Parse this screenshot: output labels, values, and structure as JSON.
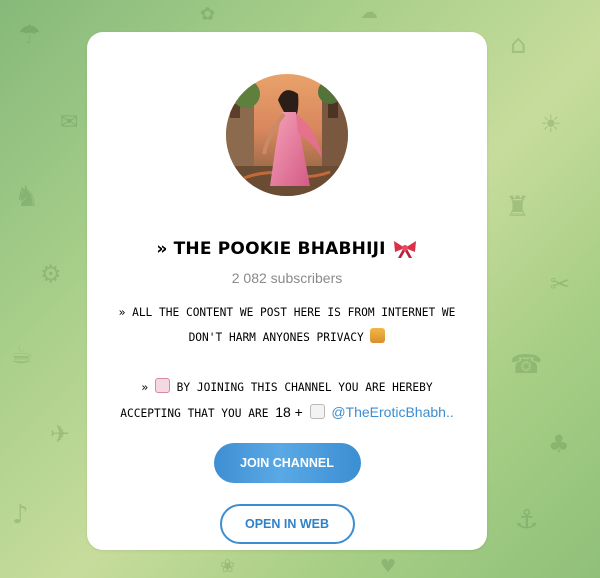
{
  "channel": {
    "title": "» THE POOKIE BHABHIJI",
    "title_icon": "ribbon-bow-icon",
    "subscribers": "2 082 subscribers",
    "description": {
      "line1": "» ALL THE CONTENT WE POST HERE IS FROM INTERNET WE",
      "line2": "DON'T HARM ANYONES PRIVACY",
      "line2_icon": "lock-icon",
      "line3_prefix": "»",
      "line3_icon": "love-letter-icon",
      "line3": "BY JOINING THIS CHANNEL YOU ARE HEREBY",
      "line4": "ACCEPTING THAT YOU ARE",
      "line4_age": "18 +",
      "line4_icon": "memo-icon",
      "mention": "@TheEroticBhabh.."
    }
  },
  "buttons": {
    "join": "JOIN CHANNEL",
    "open_web": "OPEN IN WEB"
  },
  "colors": {
    "accent": "#3a8ed1",
    "subtle_text": "#8a8a8a",
    "background_green": "#a8cf8a"
  }
}
